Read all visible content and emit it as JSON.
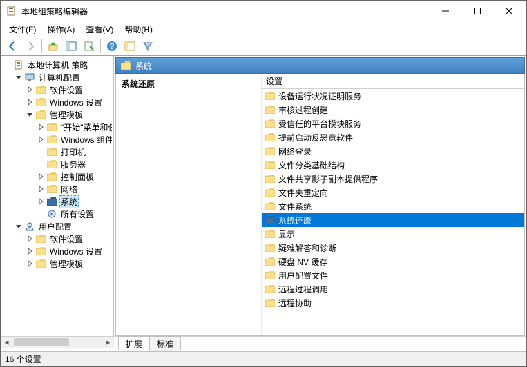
{
  "window": {
    "title": "本地组策略编辑器"
  },
  "menu": {
    "file": "文件(F)",
    "action": "操作(A)",
    "view": "查看(V)",
    "help": "帮助(H)"
  },
  "tree": {
    "root": "本地计算机 策略",
    "computer_config": "计算机配置",
    "cc_software": "软件设置",
    "cc_windows": "Windows 设置",
    "cc_admin": "管理模板",
    "cc_start": "\"开始\"菜单和任务栏",
    "cc_wincomp": "Windows 组件",
    "cc_printer": "打印机",
    "cc_server": "服务器",
    "cc_control": "控制面板",
    "cc_network": "网络",
    "cc_system": "系统",
    "cc_all": "所有设置",
    "user_config": "用户配置",
    "uc_software": "软件设置",
    "uc_windows": "Windows 设置",
    "uc_admin": "管理模板"
  },
  "right": {
    "header": "系统",
    "section_title": "系统还原",
    "col_setting": "设置",
    "items": [
      "设备运行状况证明服务",
      "审核过程创建",
      "受信任的平台模块服务",
      "提前启动反恶意软件",
      "网络登录",
      "文件分类基础结构",
      "文件共享影子副本提供程序",
      "文件夹重定向",
      "文件系统",
      "系统还原",
      "显示",
      "疑难解答和诊断",
      "硬盘 NV 缓存",
      "用户配置文件",
      "远程过程调用",
      "远程协助"
    ],
    "selected_index": 9
  },
  "tabs": {
    "extended": "扩展",
    "standard": "标准"
  },
  "status": {
    "text": "16 个设置"
  }
}
